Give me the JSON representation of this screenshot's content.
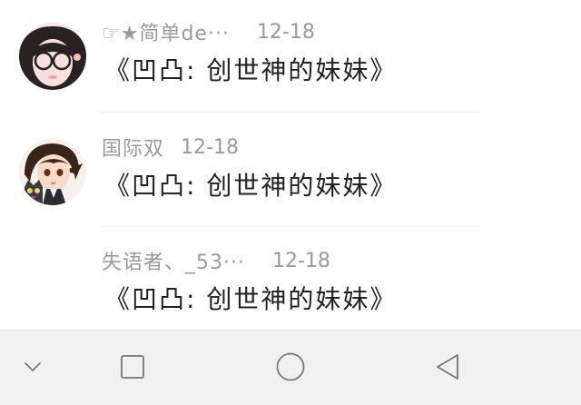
{
  "comments": [
    {
      "avatar_icon": "avatar-girl-glasses-icon",
      "username": "☞★简单de···",
      "date": "12-18",
      "text": "《凹凸: 创世神的妹妹》"
    },
    {
      "avatar_icon": "avatar-anime-boy-cat-icon",
      "username": "国际双",
      "date": "12-18",
      "text": "《凹凸: 创世神的妹妹》"
    },
    {
      "avatar_icon": "",
      "username": "失语者、_53···",
      "date": "12-18",
      "text": "《凹凸: 创世神的妹妹》"
    }
  ],
  "navbar": {
    "icons": [
      "chevron-down-icon",
      "recent-apps-icon",
      "home-icon",
      "back-icon"
    ],
    "background": "#f1f1f1"
  }
}
